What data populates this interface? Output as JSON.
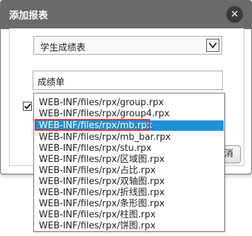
{
  "dialog": {
    "title": "添加报表",
    "close_icon": "close-icon",
    "report_select": {
      "selected": "学生成绩表"
    },
    "name_input": {
      "value": "成绩单"
    },
    "checkbox": {
      "checked": true
    },
    "cancel_label": "消"
  },
  "dropdown": {
    "options": [
      "WEB-INF/files/rpx/group.rpx",
      "WEB-INF/files/rpx/group4.rpx",
      "WEB-INF/files/rpx/mb.rpx",
      "WEB-INF/files/rpx/mb_bar.rpx",
      "WEB-INF/files/rpx/stu.rpx",
      "WEB-INF/files/rpx/区域图.rpx",
      "WEB-INF/files/rpx/占比.rpx",
      "WEB-INF/files/rpx/双轴图.rpx",
      "WEB-INF/files/rpx/折线图.rpx",
      "WEB-INF/files/rpx/条形图.rpx",
      "WEB-INF/files/rpx/柱图.rpx",
      "WEB-INF/files/rpx/饼图.rpx"
    ],
    "selected_option": "WEB-INF/files/rpx/mb.rpx"
  },
  "colors": {
    "titlebar": "#6a6a6a",
    "selection": "#1e90d8",
    "highlight": "#e0302f"
  }
}
